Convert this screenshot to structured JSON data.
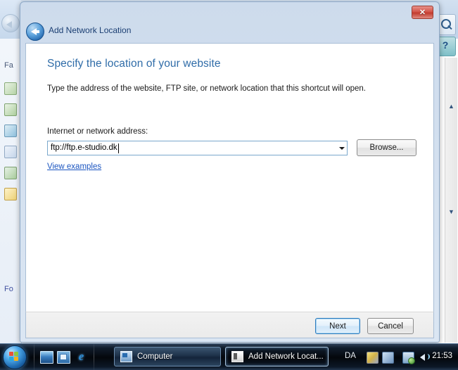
{
  "background_window": {
    "nav_header_favorites": "Fa",
    "nav_header_folders": "Fo",
    "search_icon": "search-icon",
    "help_icon": "?",
    "scroll_up": "▲",
    "scroll_down": "▼"
  },
  "dialog": {
    "title": "Add Network Location",
    "close_label": "✕",
    "back_tooltip": "Back",
    "heading": "Specify the location of your website",
    "description": "Type the address of the website, FTP site, or network location that this shortcut will open.",
    "field_label": "Internet or network address:",
    "address_value": "ftp://ftp.e-studio.dk",
    "address_placeholder": "",
    "browse_label": "Browse...",
    "examples_link": "View examples",
    "next_label": "Next",
    "cancel_label": "Cancel",
    "accent_color": "#2f6ca8",
    "link_color": "#1b55c0"
  },
  "taskbar": {
    "start_label": "Start",
    "quicklaunch": [
      {
        "name": "show-desktop-icon",
        "label": "Show desktop"
      },
      {
        "name": "switch-windows-icon",
        "label": "Switch between windows"
      },
      {
        "name": "internet-explorer-icon",
        "label": "e"
      }
    ],
    "tasks": [
      {
        "label": "Computer",
        "active": false
      },
      {
        "label": "Add Network Locat...",
        "active": true
      }
    ],
    "language_indicator": "DA",
    "tray_icons": [
      "tray-icon-1",
      "tray-icon-2",
      "network-icon",
      "volume-icon"
    ],
    "clock": "21:53"
  }
}
